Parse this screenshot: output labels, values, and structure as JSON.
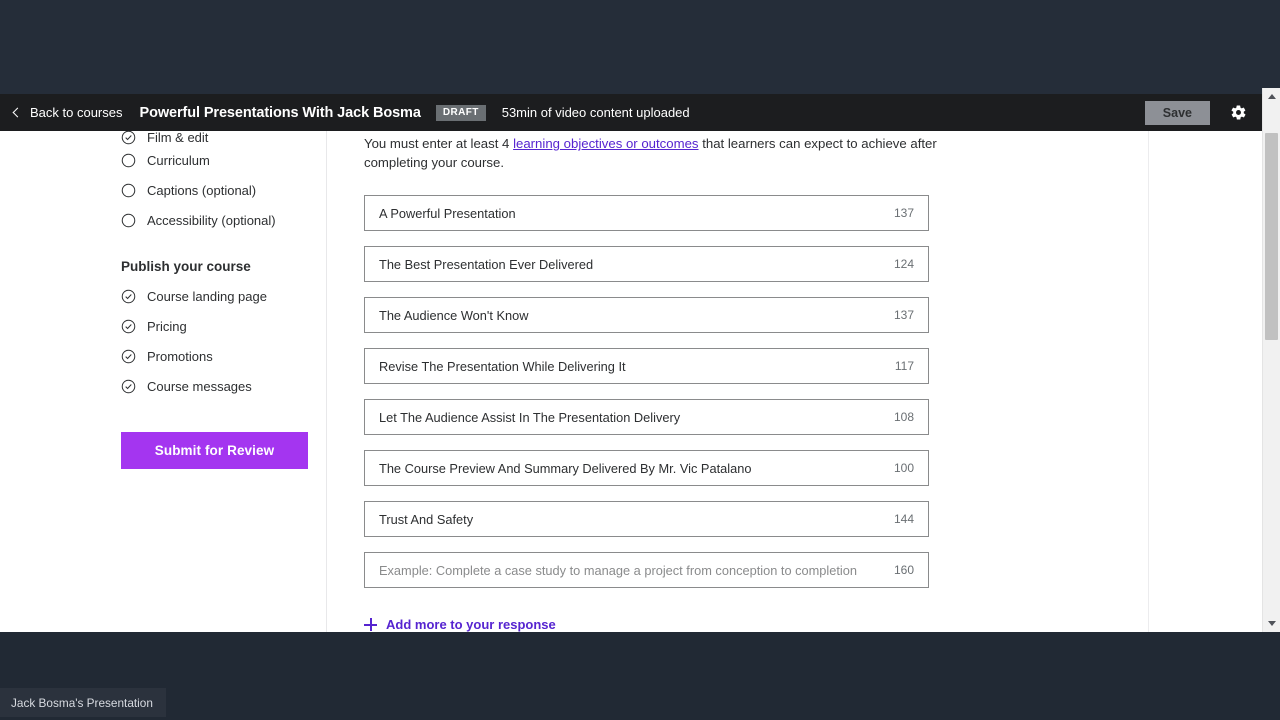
{
  "appbar": {
    "back_label": "Back to courses",
    "course_title": "Powerful Presentations With Jack Bosma",
    "status_badge": "DRAFT",
    "video_status": "53min of video content uploaded",
    "save_label": "Save",
    "accent_color": "#a435f0",
    "bar_color": "#1c1d1f"
  },
  "sidebar": {
    "items": [
      {
        "label": "Film & edit",
        "state": "complete"
      },
      {
        "label": "Curriculum",
        "state": "incomplete"
      },
      {
        "label": "Captions (optional)",
        "state": "incomplete"
      },
      {
        "label": "Accessibility (optional)",
        "state": "incomplete"
      }
    ],
    "group_heading": "Publish your course",
    "publish_items": [
      {
        "label": "Course landing page",
        "state": "complete"
      },
      {
        "label": "Pricing",
        "state": "complete"
      },
      {
        "label": "Promotions",
        "state": "complete"
      },
      {
        "label": "Course messages",
        "state": "complete"
      }
    ],
    "submit_label": "Submit for Review"
  },
  "main": {
    "intro_prefix": "You must enter at least 4 ",
    "intro_link": "learning objectives or outcomes",
    "intro_suffix": " that learners can expect to achieve after completing your course.",
    "objectives": [
      {
        "text": "A Powerful Presentation",
        "count": "137",
        "placeholder": false
      },
      {
        "text": "The Best Presentation Ever Delivered",
        "count": "124",
        "placeholder": false
      },
      {
        "text": "The Audience Won't Know",
        "count": "137",
        "placeholder": false
      },
      {
        "text": "Revise The Presentation While Delivering It",
        "count": "117",
        "placeholder": false
      },
      {
        "text": "Let The Audience Assist In The Presentation Delivery",
        "count": "108",
        "placeholder": false
      },
      {
        "text": "The Course Preview And Summary Delivered By Mr. Vic Patalano",
        "count": "100",
        "placeholder": false
      },
      {
        "text": "Trust And Safety",
        "count": "144",
        "placeholder": false
      },
      {
        "text": "Example: Complete a case study to manage a project from conception to completion",
        "count": "160",
        "placeholder": true
      }
    ],
    "add_more_label": "Add more to your response"
  },
  "taskbar": {
    "window_label": "Jack Bosma's Presentation"
  }
}
